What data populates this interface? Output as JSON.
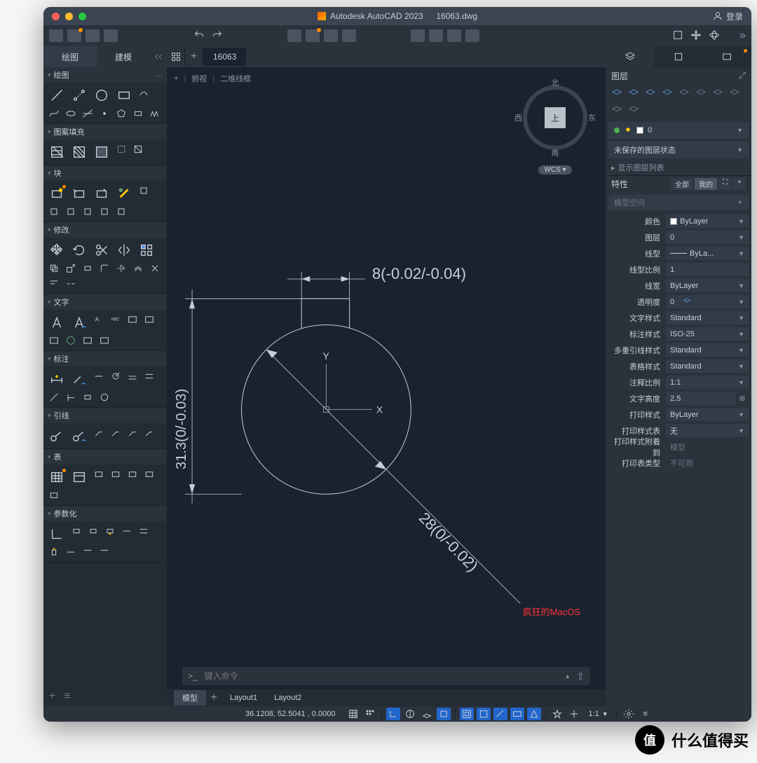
{
  "title": {
    "app": "Autodesk AutoCAD 2023",
    "file": "16063.dwg"
  },
  "login": "登录",
  "left_tabs": {
    "draw": "绘图",
    "model": "建模"
  },
  "file_tab": "16063",
  "view_labels": {
    "plus": "+",
    "top": "俯视",
    "wireframe": "二维线框"
  },
  "viewcube": {
    "n": "北",
    "s": "南",
    "e": "东",
    "w": "西",
    "face": "上",
    "wcs": "WCS"
  },
  "palette_sections": {
    "draw": "绘图",
    "hatch": "图案填充",
    "block": "块",
    "modify": "修改",
    "text": "文字",
    "dim": "标注",
    "leader": "引线",
    "table": "表",
    "param": "参数化"
  },
  "dimensions": {
    "top": "8(-0.02/-0.04)",
    "left": "31.3(0/-0.03)",
    "dia": "28(0/-0.02)"
  },
  "axes": {
    "x": "X",
    "y": "Y"
  },
  "watermark": "疯狂的MacOS",
  "cmd": {
    "prompt": ">_",
    "placeholder": "键入命令",
    "chev": "▴"
  },
  "layout_tabs": {
    "model": "模型",
    "l1": "Layout1",
    "l2": "Layout2"
  },
  "right": {
    "layers_header": "图层",
    "layer0": "0",
    "layer_state": "未保存的图层状态",
    "show_list": "显示图层列表",
    "props_header": "特性",
    "pill_all": "全部",
    "pill_my": "我的",
    "space": "模型空间",
    "props": {
      "color": {
        "label": "颜色",
        "value": "ByLayer"
      },
      "layer": {
        "label": "图层",
        "value": "0"
      },
      "linetype": {
        "label": "线型",
        "value": "ByLa..."
      },
      "ltscale": {
        "label": "线型比例",
        "value": "1"
      },
      "lineweight": {
        "label": "线宽",
        "value": "ByLayer"
      },
      "transparency": {
        "label": "透明度",
        "value": "0"
      },
      "textstyle": {
        "label": "文字样式",
        "value": "Standard"
      },
      "dimstyle": {
        "label": "标注样式",
        "value": "ISO-25"
      },
      "mleader": {
        "label": "多重引线样式",
        "value": "Standard"
      },
      "tablestyle": {
        "label": "表格样式",
        "value": "Standard"
      },
      "annoscale": {
        "label": "注释比例",
        "value": "1:1"
      },
      "textheight": {
        "label": "文字高度",
        "value": "2.5"
      },
      "plotstyle": {
        "label": "打印样式",
        "value": "ByLayer"
      },
      "plottable": {
        "label": "打印样式表",
        "value": "无"
      },
      "plotattach": {
        "label": "打印样式附着到",
        "value": "模型"
      },
      "plottype": {
        "label": "打印表类型",
        "value": "不可用"
      }
    }
  },
  "status": {
    "coord": "36.1208,  52.5041 , 0.0000",
    "scale": "1:1"
  },
  "smzdm": "什么值得买"
}
